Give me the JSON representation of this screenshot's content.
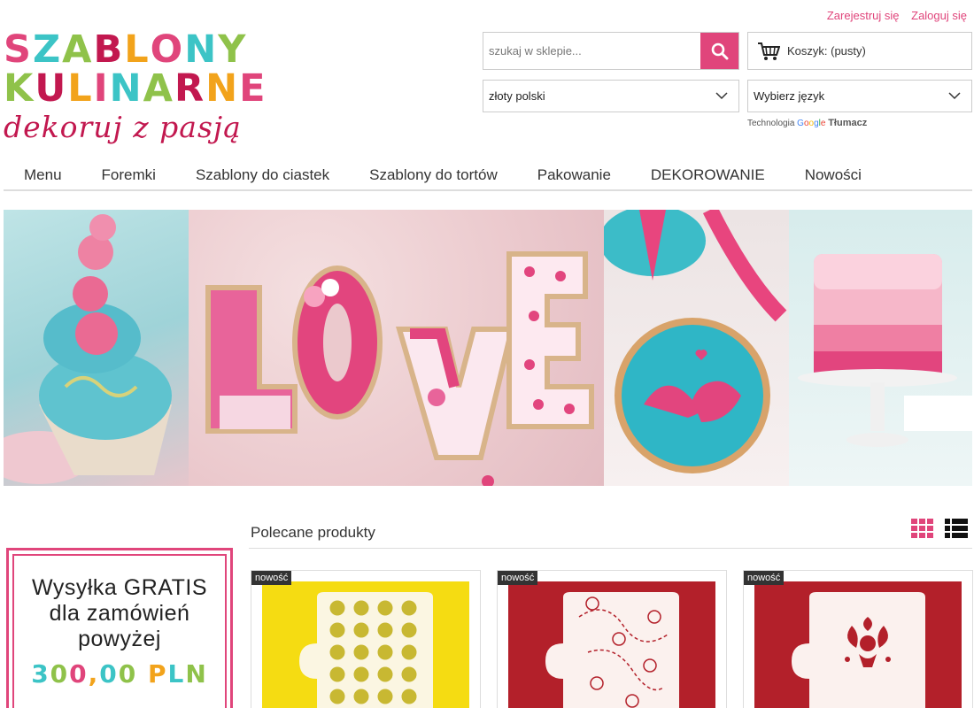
{
  "header": {
    "register_link": "Zarejestruj się",
    "login_link": "Zaloguj się",
    "logo": {
      "line1": "SZABLONY",
      "line2": "KULINARNE",
      "tagline": "dekoruj z pasją"
    },
    "search": {
      "placeholder": "szukaj w sklepie..."
    },
    "cart": {
      "label": "Koszyk: (pusty)"
    },
    "currency_select": {
      "selected": "złoty polski"
    },
    "language_select": {
      "selected": "Wybierz język"
    },
    "google_translate": {
      "prefix": "Technologia",
      "suffix": "Tłumacz"
    }
  },
  "nav": {
    "items": [
      {
        "label": "Menu"
      },
      {
        "label": "Foremki"
      },
      {
        "label": "Szablony do ciastek"
      },
      {
        "label": "Szablony do tortów"
      },
      {
        "label": "Pakowanie"
      },
      {
        "label": "DEKOROWANIE"
      },
      {
        "label": "Nowości"
      }
    ]
  },
  "promo": {
    "line1": "Wysyłka GRATIS",
    "line2": "dla zamówień",
    "line3": "powyżej",
    "amount": "300,00 PLN"
  },
  "featured": {
    "title": "Polecane produkty",
    "products": [
      {
        "badge": "nowość"
      },
      {
        "badge": "nowość"
      },
      {
        "badge": "nowość"
      }
    ]
  },
  "colors": {
    "accent": "#e0457b",
    "logo_palette": [
      "#e0457b",
      "#3cc4c6",
      "#8fc24a",
      "#c2184f",
      "#f2a31b"
    ]
  }
}
